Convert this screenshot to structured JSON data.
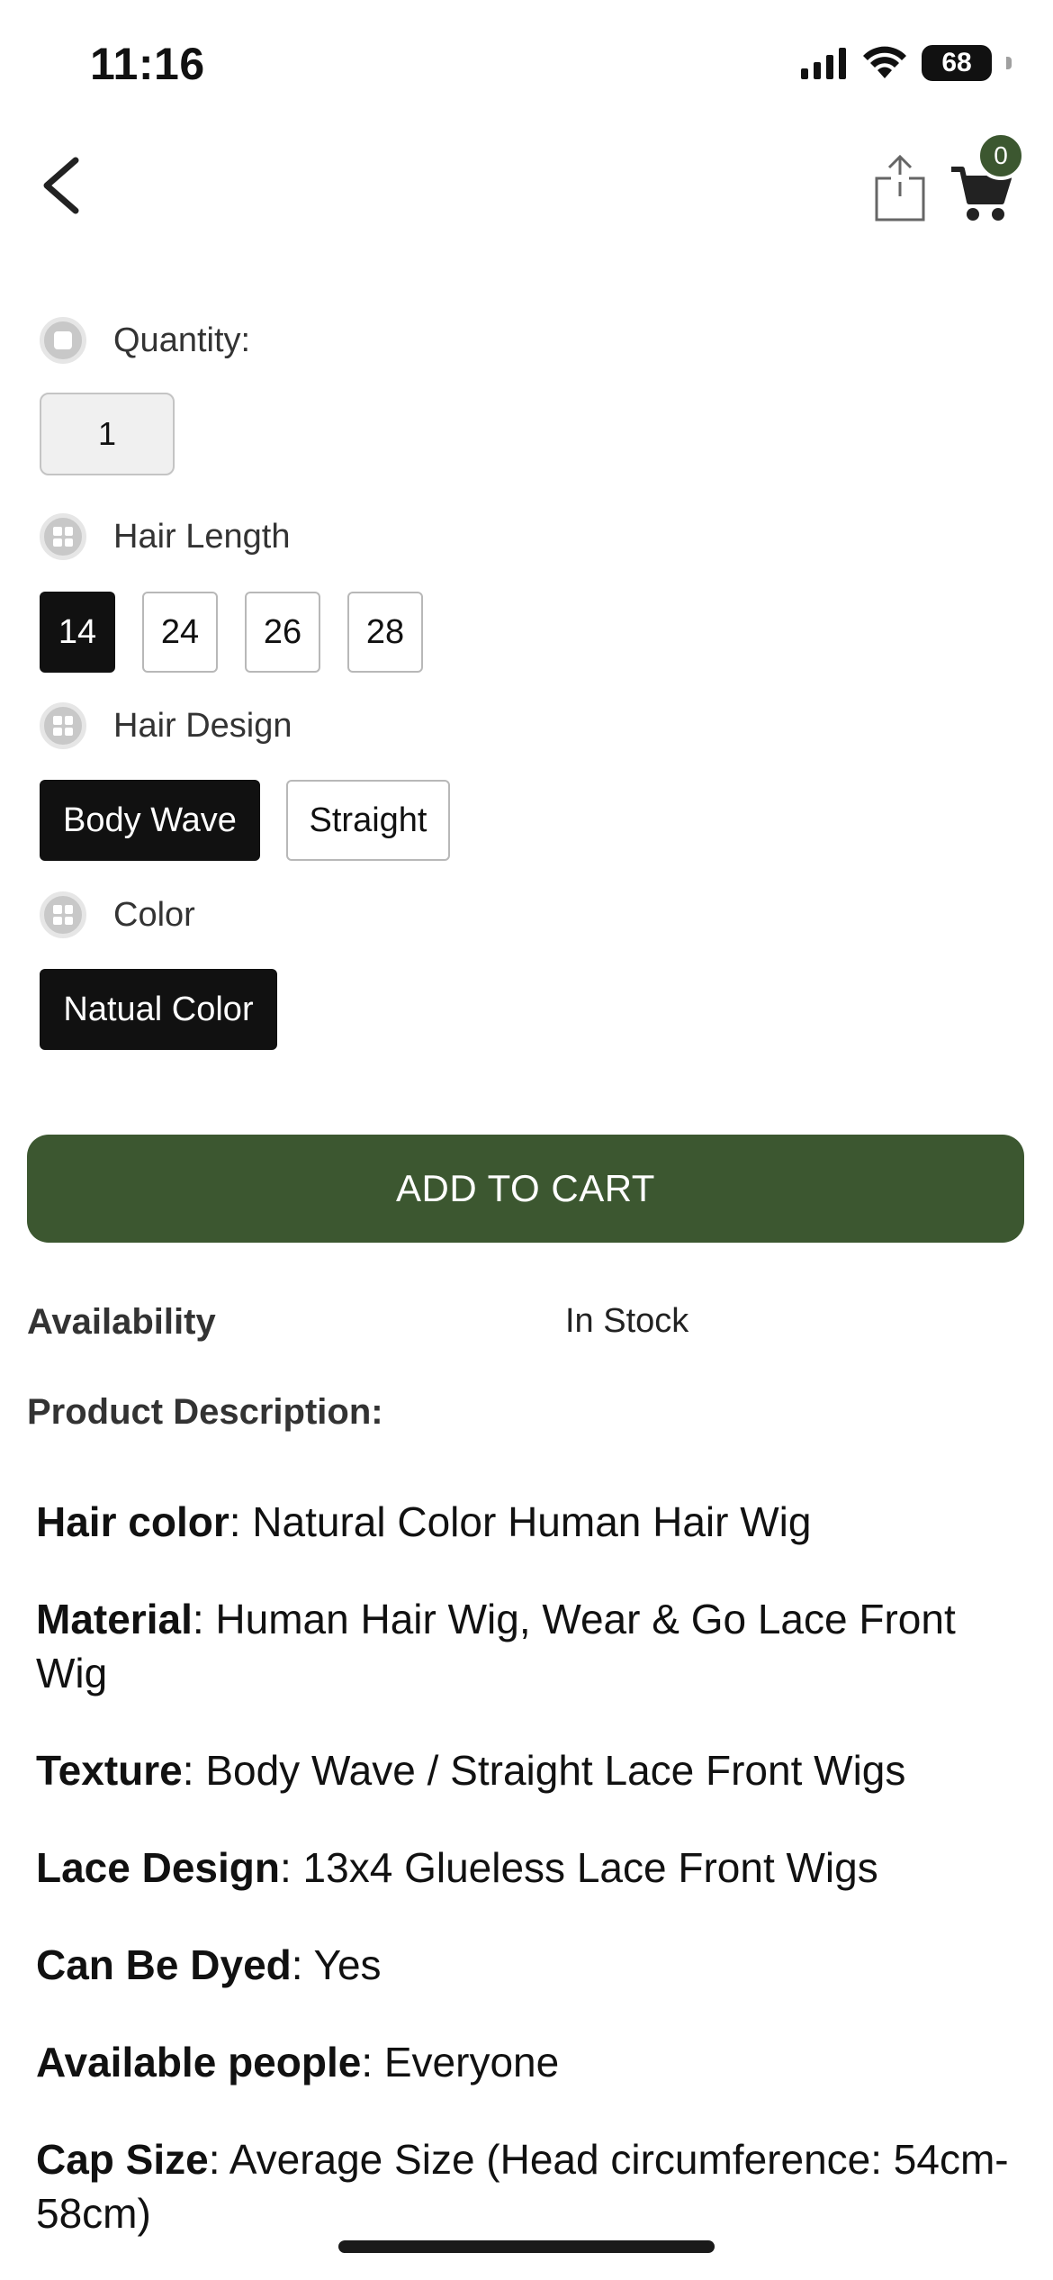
{
  "status_bar": {
    "time": "11:16",
    "battery": "68"
  },
  "header": {
    "cart_count": "0"
  },
  "options": {
    "quantity": {
      "label": "Quantity:",
      "value": "1"
    },
    "hair_length": {
      "label": "Hair Length",
      "choices": [
        "14",
        "24",
        "26",
        "28"
      ],
      "selected": "14"
    },
    "hair_design": {
      "label": "Hair Design",
      "choices": [
        "Body Wave",
        "Straight"
      ],
      "selected": "Body Wave"
    },
    "color": {
      "label": "Color",
      "choices": [
        "Natual Color"
      ],
      "selected": "Natual Color"
    }
  },
  "add_to_cart_label": "ADD TO CART",
  "availability": {
    "label": "Availability",
    "value": "In Stock"
  },
  "description": {
    "heading": "Product Description:",
    "items": [
      {
        "key": "Hair color",
        "value": ": Natural Color Human Hair Wig"
      },
      {
        "key": "Material",
        "value": ": Human Hair Wig, Wear & Go Lace Front Wig"
      },
      {
        "key": "Texture",
        "value": ": Body Wave / Straight Lace Front Wigs"
      },
      {
        "key": "Lace Design",
        "value": ": 13x4 Glueless Lace Front Wigs"
      },
      {
        "key": "Can Be Dyed",
        "value": ": Yes"
      },
      {
        "key": "Available people",
        "value": ": Everyone"
      },
      {
        "key": "Cap Size",
        "value": ": Average Size (Head circumference: 54cm-58cm)"
      }
    ]
  },
  "colors": {
    "accent_green": "#3c5730",
    "selected_chip": "#111111"
  },
  "icons": {
    "back": "chevron-left-icon",
    "share": "share-icon",
    "cart": "cart-icon"
  }
}
